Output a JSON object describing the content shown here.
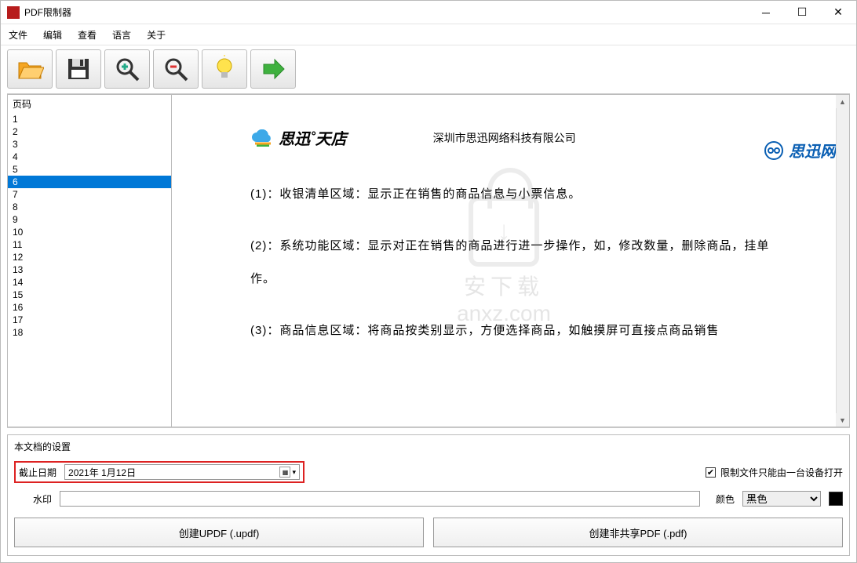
{
  "window": {
    "title": "PDF限制器"
  },
  "menu": {
    "file": "文件",
    "edit": "编辑",
    "view": "查看",
    "language": "语言",
    "about": "关于"
  },
  "toolbar_icons": {
    "open": "open-icon",
    "save": "save-icon",
    "zoom_in": "zoom-in-icon",
    "zoom_out": "zoom-out-icon",
    "bulb": "bulb-icon",
    "go": "arrow-right-icon"
  },
  "pages": {
    "header": "页码",
    "items": [
      "1",
      "2",
      "3",
      "4",
      "5",
      "6",
      "7",
      "8",
      "9",
      "10",
      "11",
      "12",
      "13",
      "14",
      "15",
      "16",
      "17",
      "18"
    ],
    "selected_index": 5
  },
  "preview": {
    "brand": "思迅˚天店",
    "company": "深圳市思迅网络科技有限公司",
    "side_brand": "思迅网",
    "para1": "(1)：收银清单区域：显示正在销售的商品信息与小票信息。",
    "para2": "(2)：系统功能区域：显示对正在销售的商品进行进一步操作，如，修改数量，删除商品，挂单",
    "para2b": "作。",
    "para3": "(3)：商品信息区域：将商品按类别显示，方便选择商品，如触摸屏可直接点商品销售",
    "watermark_text": "anxz.com"
  },
  "settings": {
    "title": "本文档的设置",
    "date_label": "截止日期",
    "date_value": "2021年  1月12日",
    "restrict_label": "限制文件只能由一台设备打开",
    "restrict_checked": true,
    "watermark_label": "水印",
    "watermark_value": "",
    "color_label": "颜色",
    "color_options": [
      "黑色"
    ],
    "color_selected": "黑色",
    "btn_updf": "创建UPDF (.updf)",
    "btn_pdf": "创建非共享PDF (.pdf)"
  }
}
